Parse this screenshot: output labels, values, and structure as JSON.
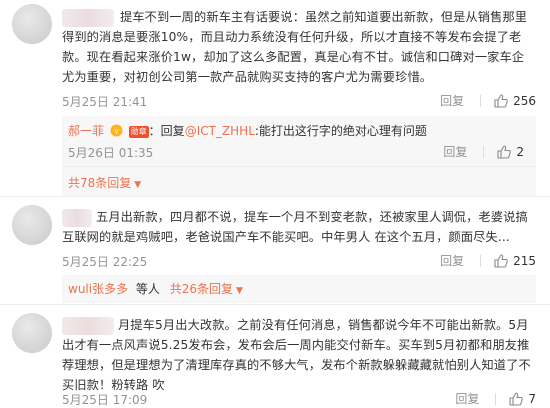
{
  "comments": [
    {
      "text": "提车不到一周的新车主有话要说：虽然之前知道要出新款，但是从销售那里得到的消息是要涨10%，而且动力系统没有任何升级，所以才直接不等发布会提了老款。现在看起来涨价1w，却加了这么多配置，真是心有不甘。诚信和口碑对一家车企尤为重要，对初创公司第一款产品就购买支持的客户尤为需要珍惜。",
      "time": "5月25日 21:41",
      "reply_label": "回复",
      "likes": "256",
      "sub": {
        "username": "郝一菲",
        "badge": "勋章",
        "reply_prefix": "：回复",
        "mention": "@ICT_ZHHL",
        "content": ":能打出这行字的绝对心理有问题",
        "time": "5月26日 01:35",
        "reply_label": "回复",
        "likes": "2"
      },
      "more": "共78条回复"
    },
    {
      "text": "五月出新款，四月都不说，提车一个月不到变老款，还被家里人调侃，老婆说搞互联网的就是鸡贼吧，老爸说国产车不能买吧。中年男人 在这个五月，颜面尽失...",
      "time": "5月25日 22:25",
      "reply_label": "回复",
      "likes": "215",
      "sub": {
        "username": "wuli张多多",
        "content": "等人",
        "more_inline": "共26条回复"
      }
    },
    {
      "text": "月提车5月出大改款。之前没有任何消息，销售都说今年不可能出新款。5月出才有一点风声说5.25发布会，发布会后一周内能交付新车。买车到5月初都和朋友推荐理想，但是理想为了清理库存真的不够大气，发布个新款躲躲藏藏就怕别人知道了不买旧款！粉转路  吹",
      "time": "5月25日 17:09",
      "reply_label": "回复",
      "likes": "7"
    }
  ],
  "colors": {
    "link": "#eb7350",
    "mention": "#1e6cb3",
    "meta": "#939393"
  },
  "icons": {
    "like": "thumbs-up-icon",
    "caret": "chevron-down-icon"
  }
}
